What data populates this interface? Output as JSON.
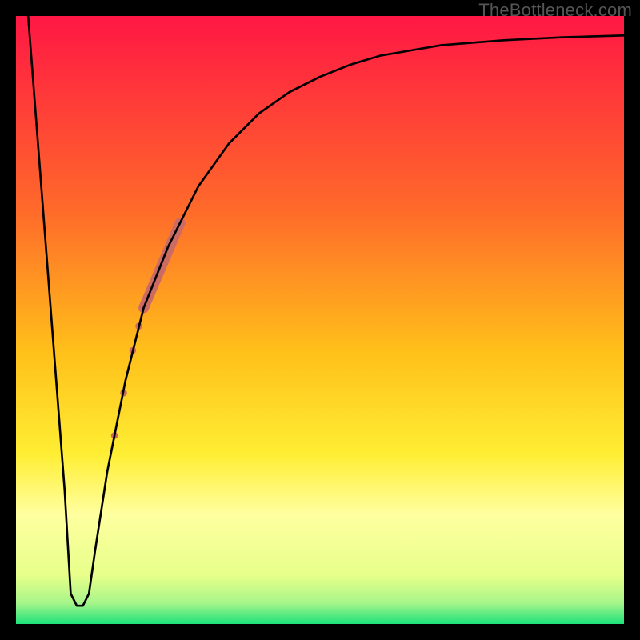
{
  "watermark": "TheBottleneck.com",
  "chart_data": {
    "type": "line",
    "title": "",
    "xlabel": "",
    "ylabel": "",
    "xlim": [
      0,
      100
    ],
    "ylim": [
      0,
      100
    ],
    "grid": false,
    "legend": false,
    "background_gradient_stops": [
      {
        "pct": 0.0,
        "color": "#ff1744"
      },
      {
        "pct": 0.32,
        "color": "#ff6a2a"
      },
      {
        "pct": 0.55,
        "color": "#ffbf1a"
      },
      {
        "pct": 0.72,
        "color": "#ffee33"
      },
      {
        "pct": 0.82,
        "color": "#ffffa0"
      },
      {
        "pct": 0.92,
        "color": "#e7ff8a"
      },
      {
        "pct": 0.965,
        "color": "#a8f58a"
      },
      {
        "pct": 1.0,
        "color": "#1de27a"
      }
    ],
    "curve": {
      "name": "bottleneck-curve",
      "x": [
        2,
        4,
        6,
        8,
        9,
        10,
        11,
        12,
        13,
        15,
        18,
        21,
        25,
        30,
        35,
        40,
        45,
        50,
        55,
        60,
        70,
        80,
        90,
        100
      ],
      "y": [
        100,
        74,
        48,
        22,
        5,
        3,
        3,
        5,
        12,
        25,
        40,
        52,
        62,
        72,
        79,
        84,
        87.5,
        90,
        92,
        93.5,
        95.2,
        96.0,
        96.5,
        96.8
      ]
    },
    "highlight_segment": {
      "name": "marker-band",
      "color": "#cc6b63",
      "thick_width": 13,
      "thin_width": 9,
      "thick": {
        "x": [
          21,
          27
        ],
        "y": [
          52,
          66
        ]
      },
      "dots": [
        {
          "x": 20.2,
          "y": 49,
          "r": 4.3
        },
        {
          "x": 19.2,
          "y": 45,
          "r": 4.3
        },
        {
          "x": 17.7,
          "y": 38,
          "r": 4.3
        },
        {
          "x": 16.2,
          "y": 31,
          "r": 4.3
        }
      ]
    }
  }
}
